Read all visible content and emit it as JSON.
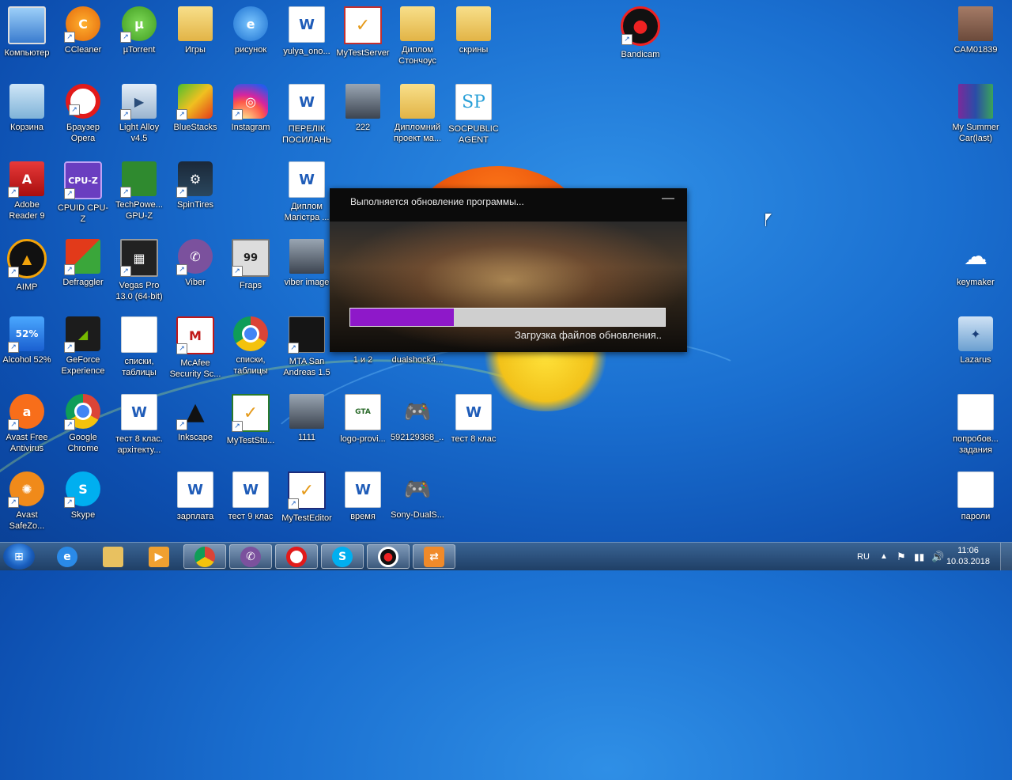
{
  "desktop": {
    "icons": [
      {
        "label": "Компьютер"
      },
      {
        "label": "CCleaner"
      },
      {
        "label": "µTorrent"
      },
      {
        "label": "Игры"
      },
      {
        "label": "рисунок"
      },
      {
        "label": "yulya_ono..."
      },
      {
        "label": "MyTestServer"
      },
      {
        "label": "Диплом Стончоус"
      },
      {
        "label": "скрины"
      },
      {
        "label": "Bandicam"
      },
      {
        "label": "CAM01839"
      },
      {
        "label": "Корзина"
      },
      {
        "label": "Браузер Opera"
      },
      {
        "label": "Light Alloy v4.5"
      },
      {
        "label": "BlueStacks"
      },
      {
        "label": "Instagram"
      },
      {
        "label": "ПЕРЕЛІК ПОСИЛАНЬ"
      },
      {
        "label": "222"
      },
      {
        "label": "Дипломний проект ма..."
      },
      {
        "label": "SOCPUBLIC AGENT"
      },
      {
        "label": "My Summer Car(last)"
      },
      {
        "label": "Adobe Reader 9"
      },
      {
        "label": "CPUID CPU-Z"
      },
      {
        "label": "TechPowe... GPU-Z"
      },
      {
        "label": "SpinTires"
      },
      {
        "label": "Диплом Магістра ..."
      },
      {
        "label": "AIMP"
      },
      {
        "label": "Defraggler"
      },
      {
        "label": "Vegas Pro 13.0 (64-bit)"
      },
      {
        "label": "Viber"
      },
      {
        "label": "Fraps"
      },
      {
        "label": "viber image"
      },
      {
        "label": "keymaker"
      },
      {
        "label": "Alcohol 52%"
      },
      {
        "label": "GeForce Experience"
      },
      {
        "label": "списки, таблицы"
      },
      {
        "label": "McAfee Security Sc..."
      },
      {
        "label": "списки, таблицы"
      },
      {
        "label": "MTA San Andreas 1.5"
      },
      {
        "label": "1 и 2"
      },
      {
        "label": "dualshock4..."
      },
      {
        "label": "Lazarus"
      },
      {
        "label": "Avast Free Antivirus"
      },
      {
        "label": "Google Chrome"
      },
      {
        "label": "тест 8 клас. архітекту..."
      },
      {
        "label": "Inkscape"
      },
      {
        "label": "MyTestStu..."
      },
      {
        "label": "1111"
      },
      {
        "label": "logo-provi..."
      },
      {
        "label": "592129368_..."
      },
      {
        "label": "тест 8 клас"
      },
      {
        "label": "попробов... задания"
      },
      {
        "label": "Avast SafeZo..."
      },
      {
        "label": "Skype"
      },
      {
        "label": "зарплата"
      },
      {
        "label": "тест 9 клас"
      },
      {
        "label": "MyTestEditor"
      },
      {
        "label": "время"
      },
      {
        "label": "Sony-DualS..."
      },
      {
        "label": "пароли"
      }
    ]
  },
  "dialog": {
    "title": "Выполняется обновление программы...",
    "minimize": "—",
    "progress_percent": 33,
    "status": "Загрузка файлов обновления.."
  },
  "taskbar": {
    "language": "RU",
    "time": "11:06",
    "date": "10.03.2018"
  }
}
